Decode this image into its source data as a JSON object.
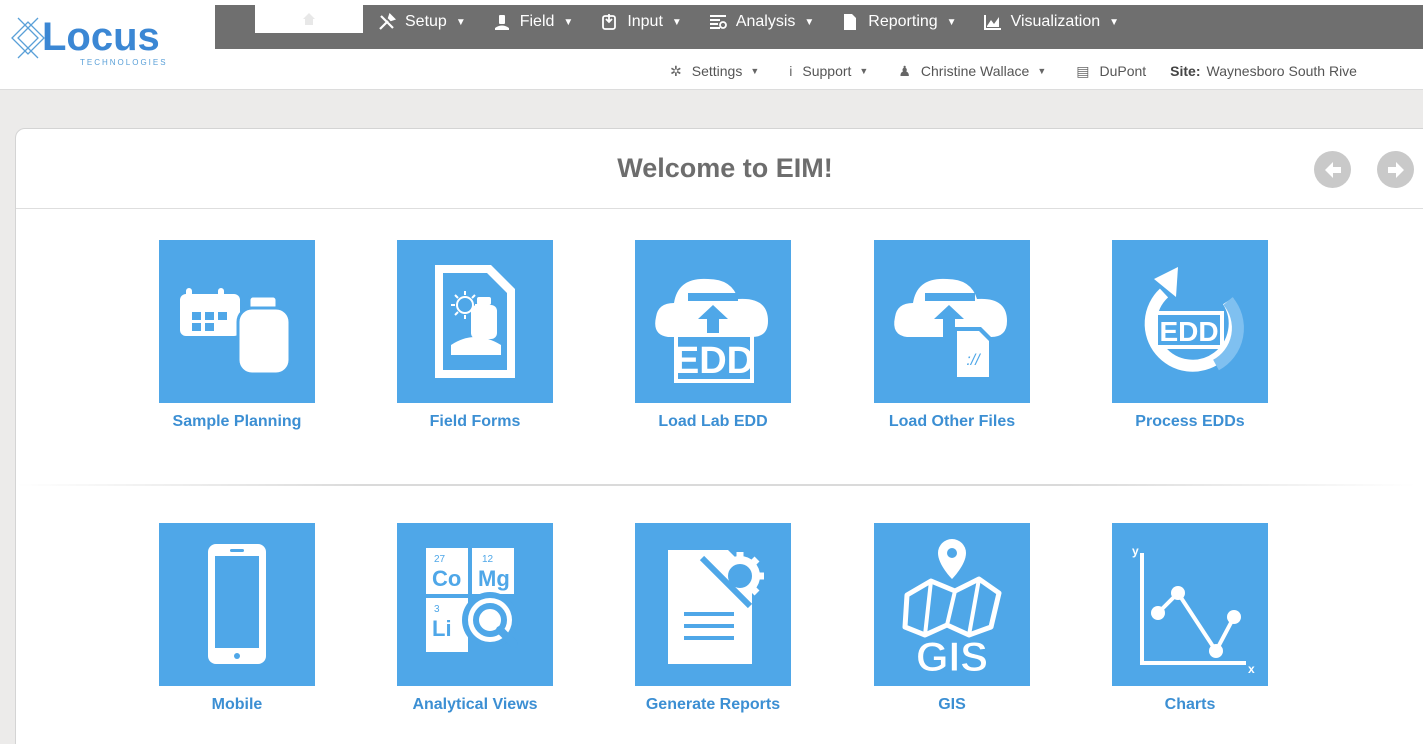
{
  "brand": {
    "name": "Locus",
    "sub": "TECHNOLOGIES"
  },
  "menu": {
    "items": [
      {
        "label": "Setup",
        "icon": "tools-icon"
      },
      {
        "label": "Field",
        "icon": "field-icon"
      },
      {
        "label": "Input",
        "icon": "input-icon"
      },
      {
        "label": "Analysis",
        "icon": "analysis-icon"
      },
      {
        "label": "Reporting",
        "icon": "document-icon"
      },
      {
        "label": "Visualization",
        "icon": "chart-icon"
      }
    ]
  },
  "subbar": {
    "settings": "Settings",
    "support": "Support",
    "user": "Christine Wallace",
    "company": "DuPont",
    "site_label": "Site:",
    "site_value": "Waynesboro South Rive"
  },
  "welcome": {
    "title": "Welcome to EIM!"
  },
  "tiles_row1": [
    {
      "label": "Sample Planning"
    },
    {
      "label": "Field Forms"
    },
    {
      "label": "Load Lab EDD"
    },
    {
      "label": "Load Other Files"
    },
    {
      "label": "Process EDDs"
    }
  ],
  "tiles_row2": [
    {
      "label": "Mobile"
    },
    {
      "label": "Analytical Views"
    },
    {
      "label": "Generate Reports"
    },
    {
      "label": "GIS"
    },
    {
      "label": "Charts"
    }
  ],
  "icon_text": {
    "edd": "EDD",
    "file_link": "://",
    "gis": "GIS",
    "element1_num": "27",
    "element1_sym": "Co",
    "element2_num": "12",
    "element2_sym": "Mg",
    "element3_num": "3",
    "element3_sym": "Li",
    "axis_y": "y",
    "axis_x": "x"
  },
  "colors": {
    "menubar": "#6f6f6f",
    "tile": "#4fa7e8",
    "tile_label": "#3c8fd3",
    "brand": "#4a90d9"
  }
}
